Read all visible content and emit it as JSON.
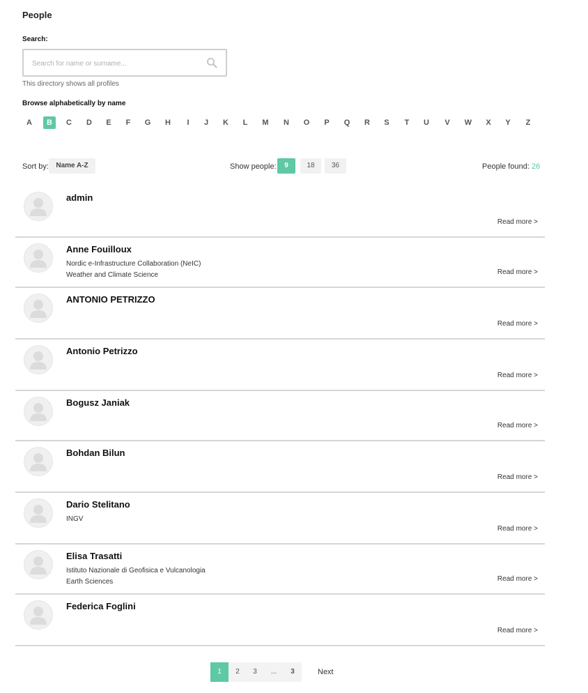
{
  "page": {
    "title": "People"
  },
  "search": {
    "label": "Search:",
    "placeholder": "Search for name or surname...",
    "note": "This directory shows all profiles"
  },
  "browse": {
    "label": "Browse alphabetically by name",
    "letters": [
      "A",
      "B",
      "C",
      "D",
      "E",
      "F",
      "G",
      "H",
      "I",
      "J",
      "K",
      "L",
      "M",
      "N",
      "O",
      "P",
      "Q",
      "R",
      "S",
      "T",
      "U",
      "V",
      "W",
      "X",
      "Y",
      "Z"
    ],
    "active": "B"
  },
  "controls": {
    "sort_label": "Sort by:",
    "sort_value": "Name A-Z",
    "show_label": "Show people:",
    "show_options": [
      "9",
      "18",
      "36"
    ],
    "show_active": "9",
    "found_label": "People found:",
    "found_count": "26"
  },
  "people": [
    {
      "name": "admin",
      "lines": []
    },
    {
      "name": "Anne Fouilloux",
      "lines": [
        "Nordic e-Infrastructure Collaboration (NeIC)",
        "Weather and Climate Science"
      ]
    },
    {
      "name": "ANTONIO PETRIZZO",
      "lines": []
    },
    {
      "name": "Antonio Petrizzo",
      "lines": []
    },
    {
      "name": "Bogusz Janiak",
      "lines": []
    },
    {
      "name": "Bohdan Bilun",
      "lines": []
    },
    {
      "name": "Dario Stelitano",
      "lines": [
        "INGV"
      ]
    },
    {
      "name": "Elisa Trasatti",
      "lines": [
        "Istituto Nazionale di Geofisica e Vulcanologia",
        "Earth Sciences"
      ]
    },
    {
      "name": "Federica Foglini",
      "lines": []
    }
  ],
  "read_more_label": "Read more >",
  "pagination": {
    "pages": [
      "1",
      "2",
      "3",
      "...",
      "3"
    ],
    "active": "1",
    "next_label": "Next"
  },
  "colors": {
    "accent": "#5fc8a5"
  }
}
